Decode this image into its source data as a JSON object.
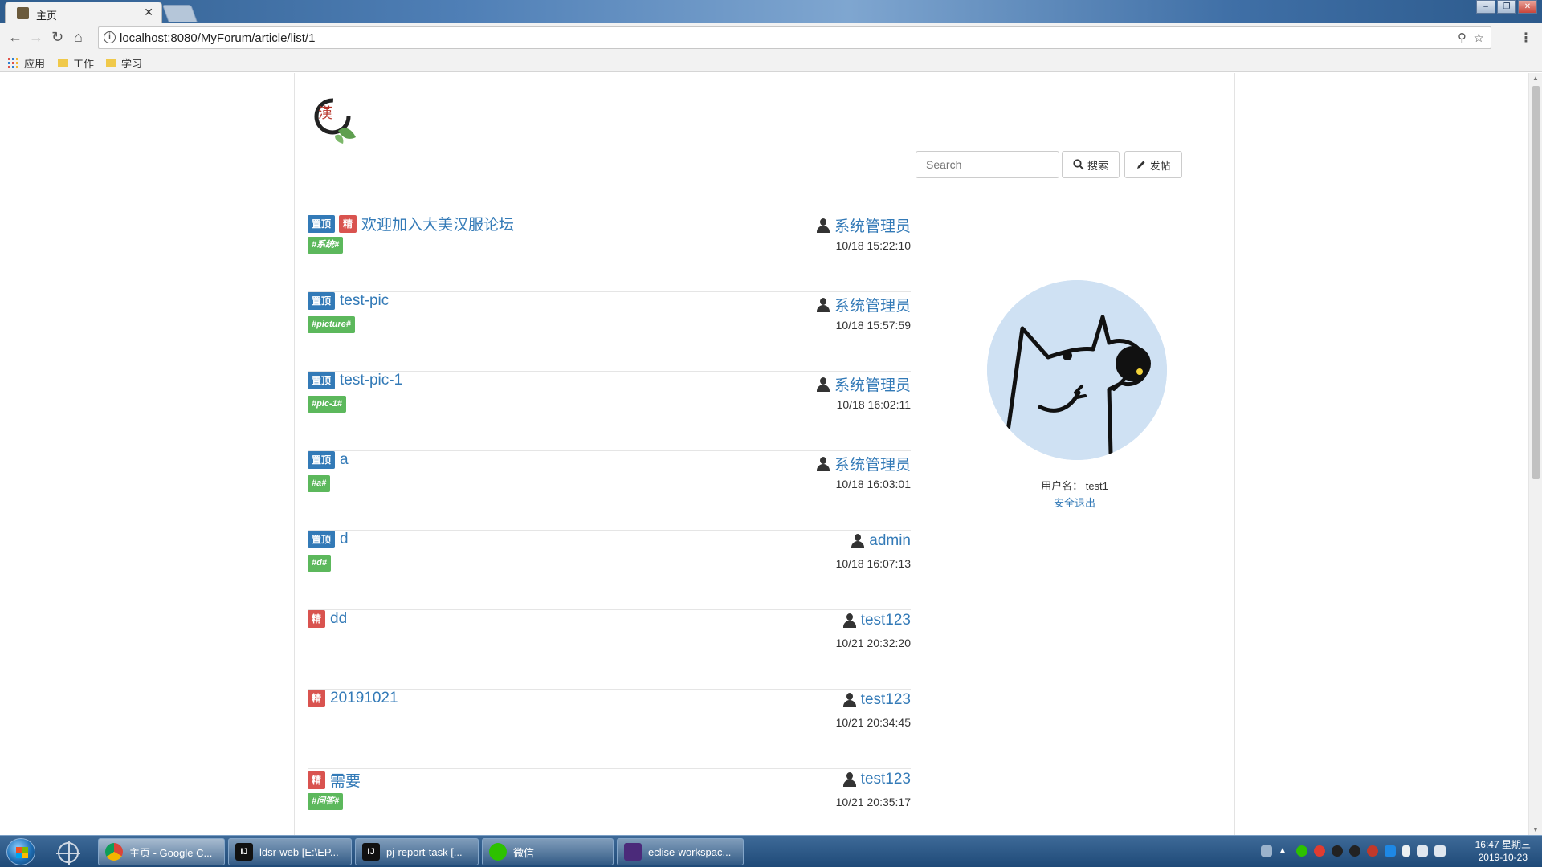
{
  "browser": {
    "tab_title": "主页",
    "tab_close": "✕",
    "url": "localhost:8080/MyForum/article/list/1",
    "bookmarks": [
      {
        "label": "应用",
        "icon": "apps-grid-icon"
      },
      {
        "label": "工作",
        "icon": "folder-icon"
      },
      {
        "label": "学习",
        "icon": "folder-icon"
      }
    ]
  },
  "header": {
    "search_placeholder": "Search",
    "search_button": "搜索",
    "post_button": "发帖"
  },
  "articles": [
    {
      "badges": [
        "top",
        "fine"
      ],
      "title": "欢迎加入大美汉服论坛",
      "tag": "#系统#",
      "author": "系统管理员",
      "time": "10/18 15:22:10"
    },
    {
      "badges": [
        "top"
      ],
      "title": "test-pic",
      "tag": "#picture#",
      "author": "系统管理员",
      "time": "10/18 15:57:59"
    },
    {
      "badges": [
        "top"
      ],
      "title": "test-pic-1",
      "tag": "#pic-1#",
      "author": "系统管理员",
      "time": "10/18 16:02:11"
    },
    {
      "badges": [
        "top"
      ],
      "title": "a",
      "tag": "#a#",
      "author": "系统管理员",
      "time": "10/18 16:03:01"
    },
    {
      "badges": [
        "top"
      ],
      "title": "d",
      "tag": "#d#",
      "author": "admin",
      "time": "10/18 16:07:13"
    },
    {
      "badges": [
        "fine"
      ],
      "title": "dd",
      "tag": "",
      "author": "test123",
      "time": "10/21 20:32:20"
    },
    {
      "badges": [
        "fine"
      ],
      "title": "20191021",
      "tag": "",
      "author": "test123",
      "time": "10/21 20:34:45"
    },
    {
      "badges": [
        "fine"
      ],
      "title": "需要",
      "tag": "#问答#",
      "author": "test123",
      "time": "10/21 20:35:17"
    }
  ],
  "badge_labels": {
    "top": "置顶",
    "fine": "精"
  },
  "profile": {
    "username_text": "用户名： test1",
    "logout": "安全退出"
  },
  "taskbar": {
    "tasks": [
      {
        "label": "主页 - Google C...",
        "icon": "chrome-icon",
        "active": true
      },
      {
        "label": "ldsr-web [E:\\EP...",
        "icon": "intellij-icon",
        "active": false
      },
      {
        "label": "pj-report-task [...",
        "icon": "intellij-icon",
        "active": false
      },
      {
        "label": "微信",
        "icon": "wechat-icon",
        "active": false
      },
      {
        "label": "eclise-workspac...",
        "icon": "eclipse-icon",
        "active": false
      }
    ],
    "clock_time": "16:47 星期三",
    "clock_date": "2019-10-23"
  },
  "colors": {
    "link": "#337ab7",
    "label_top": "#337ab7",
    "label_fine": "#d9534f",
    "label_tag": "#5cb85c"
  }
}
